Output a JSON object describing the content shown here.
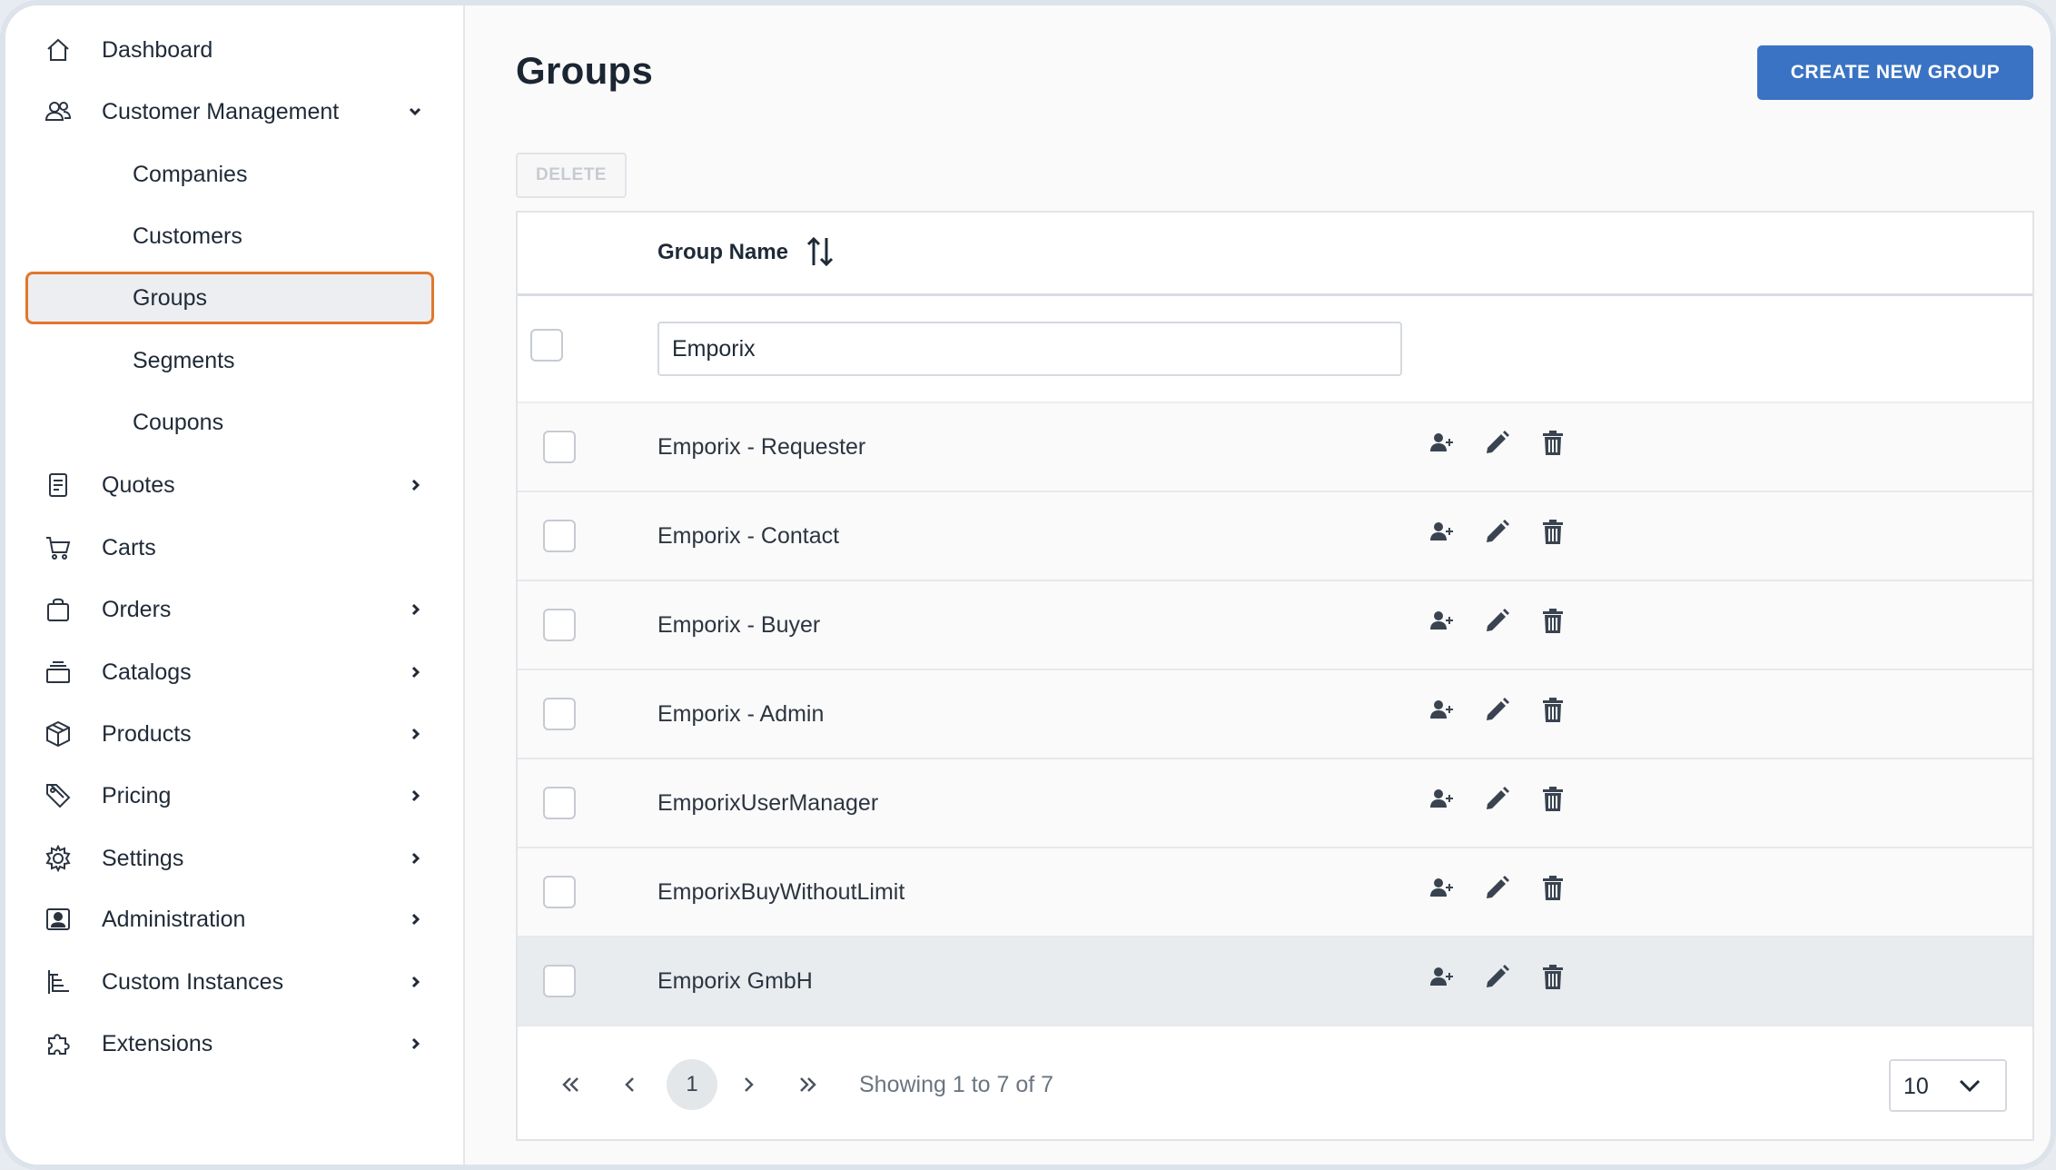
{
  "sidebar": {
    "items": [
      {
        "label": "Dashboard",
        "icon": "home-icon"
      },
      {
        "label": "Customer Management",
        "icon": "users-icon",
        "expanded": true
      },
      {
        "label": "Companies"
      },
      {
        "label": "Customers"
      },
      {
        "label": "Groups",
        "active": true
      },
      {
        "label": "Segments"
      },
      {
        "label": "Coupons"
      },
      {
        "label": "Quotes",
        "icon": "document-icon"
      },
      {
        "label": "Carts",
        "icon": "cart-icon"
      },
      {
        "label": "Orders",
        "icon": "bag-icon"
      },
      {
        "label": "Catalogs",
        "icon": "layers-icon"
      },
      {
        "label": "Products",
        "icon": "box-icon"
      },
      {
        "label": "Pricing",
        "icon": "tag-icon"
      },
      {
        "label": "Settings",
        "icon": "gear-icon"
      },
      {
        "label": "Administration",
        "icon": "admin-icon"
      },
      {
        "label": "Custom Instances",
        "icon": "hierarchy-icon"
      },
      {
        "label": "Extensions",
        "icon": "puzzle-icon"
      }
    ]
  },
  "main": {
    "title": "Groups",
    "create_label": "CREATE NEW GROUP",
    "delete_label": "DELETE",
    "table": {
      "header_name": "Group Name",
      "filter_value": "Emporix",
      "rows": [
        {
          "name": "Emporix - Requester"
        },
        {
          "name": "Emporix - Contact"
        },
        {
          "name": "Emporix - Buyer"
        },
        {
          "name": "Emporix - Admin"
        },
        {
          "name": "EmporixUserManager"
        },
        {
          "name": "EmporixBuyWithoutLimit"
        },
        {
          "name": "Emporix GmbH",
          "hovered": true
        }
      ]
    },
    "pager": {
      "current_page": "1",
      "info": "Showing 1 to 7 of 7",
      "page_size": "10"
    }
  },
  "colors": {
    "accent": "#3a73c4",
    "active_border": "#e2772c"
  }
}
